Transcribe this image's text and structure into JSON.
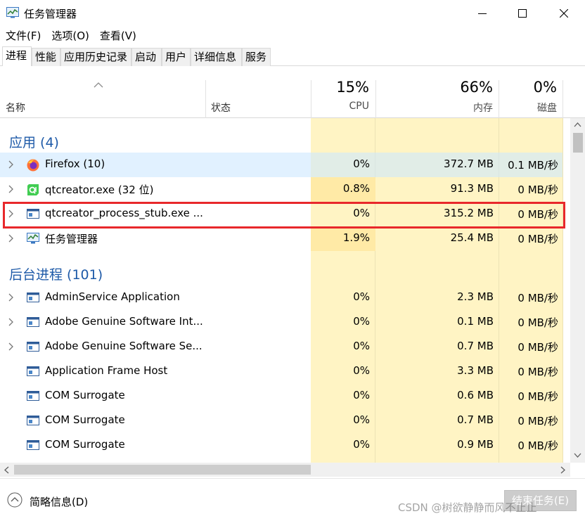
{
  "window": {
    "title": "任务管理器"
  },
  "menu": [
    "文件(F)",
    "选项(O)",
    "查看(V)"
  ],
  "tabs": [
    "进程",
    "性能",
    "应用历史记录",
    "启动",
    "用户",
    "详细信息",
    "服务"
  ],
  "columns": {
    "name": "名称",
    "status": "状态",
    "cpu": {
      "pct": "15%",
      "label": "CPU"
    },
    "memory": {
      "pct": "66%",
      "label": "内存"
    },
    "disk": {
      "pct": "0%",
      "label": "磁盘"
    }
  },
  "groups": {
    "apps": "应用 (4)",
    "background": "后台进程 (101)"
  },
  "apps": [
    {
      "name": "Firefox (10)",
      "cpu": "0%",
      "mem": "372.7 MB",
      "disk": "0.1 MB/秒",
      "icon": "firefox-icon"
    },
    {
      "name": "qtcreator.exe (32 位)",
      "cpu": "0.8%",
      "mem": "91.3 MB",
      "disk": "0 MB/秒",
      "icon": "qt-icon"
    },
    {
      "name": "qtcreator_process_stub.exe ...",
      "cpu": "0%",
      "mem": "315.2 MB",
      "disk": "0 MB/秒",
      "icon": "window-app-icon"
    },
    {
      "name": "任务管理器",
      "cpu": "1.9%",
      "mem": "25.4 MB",
      "disk": "0 MB/秒",
      "icon": "task-manager-icon"
    }
  ],
  "background": [
    {
      "name": "AdminService Application",
      "cpu": "0%",
      "mem": "2.3 MB",
      "disk": "0 MB/秒"
    },
    {
      "name": "Adobe Genuine Software Int...",
      "cpu": "0%",
      "mem": "0.1 MB",
      "disk": "0 MB/秒"
    },
    {
      "name": "Adobe Genuine Software Se...",
      "cpu": "0%",
      "mem": "0.7 MB",
      "disk": "0 MB/秒"
    },
    {
      "name": "Application Frame Host",
      "cpu": "0%",
      "mem": "3.3 MB",
      "disk": "0 MB/秒"
    },
    {
      "name": "COM Surrogate",
      "cpu": "0%",
      "mem": "0.6 MB",
      "disk": "0 MB/秒"
    },
    {
      "name": "COM Surrogate",
      "cpu": "0%",
      "mem": "0.7 MB",
      "disk": "0 MB/秒"
    },
    {
      "name": "COM Surrogate",
      "cpu": "0%",
      "mem": "0.9 MB",
      "disk": "0 MB/秒"
    }
  ],
  "footer": {
    "fewer_details": "简略信息(D)",
    "end_task": "结束任务(E)",
    "watermark": "CSDN @树欲静静而风不止止"
  },
  "colors": {
    "heat_light": "#fff4c4",
    "heat_medium": "#ffeaa6",
    "group_title": "#1e5aa8",
    "annotation_box": "#e8282b"
  }
}
